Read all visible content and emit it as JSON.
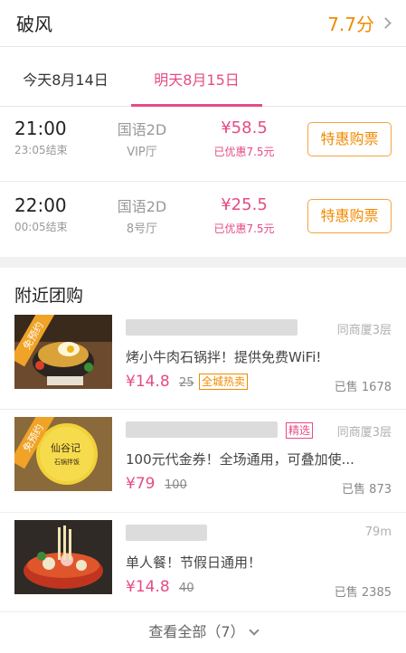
{
  "movie": {
    "title": "破风",
    "rating": "7.7分"
  },
  "date_tabs": [
    {
      "label": "今天8月14日",
      "selected": false
    },
    {
      "label": "明天8月15日",
      "selected": true
    }
  ],
  "showtimes": [
    {
      "time": "21:00",
      "end": "23:05结束",
      "lang": "国语2D",
      "hall": "VIP厅",
      "price": "¥58.5",
      "discount": "已优惠7.5元",
      "button": "特惠购票"
    },
    {
      "time": "22:00",
      "end": "00:05结束",
      "lang": "国语2D",
      "hall": "8号厅",
      "price": "¥25.5",
      "discount": "已优惠7.5元",
      "button": "特惠购票"
    }
  ],
  "group_section": {
    "title": "附近团购",
    "deals": [
      {
        "badge": "免预约",
        "distance": "同商厦3层",
        "desc": "烤小牛肉石锅拌！提供免费WiFi!",
        "price": "¥14.8",
        "original": "25",
        "tag": "全城热卖",
        "sold": "已售 1678"
      },
      {
        "badge": "免预约",
        "select_tag": "精选",
        "distance": "同商厦3层",
        "desc": "100元代金券！全场通用，可叠加使...",
        "price": "¥79",
        "original": "100",
        "sold": "已售 873"
      },
      {
        "distance": "79m",
        "desc": "单人餐！节假日通用！",
        "price": "¥14.8",
        "original": "40",
        "sold": "已售 2385"
      }
    ],
    "view_all": "查看全部（7）"
  },
  "colors": {
    "accent": "#e54b86",
    "orange": "#f08a00"
  }
}
